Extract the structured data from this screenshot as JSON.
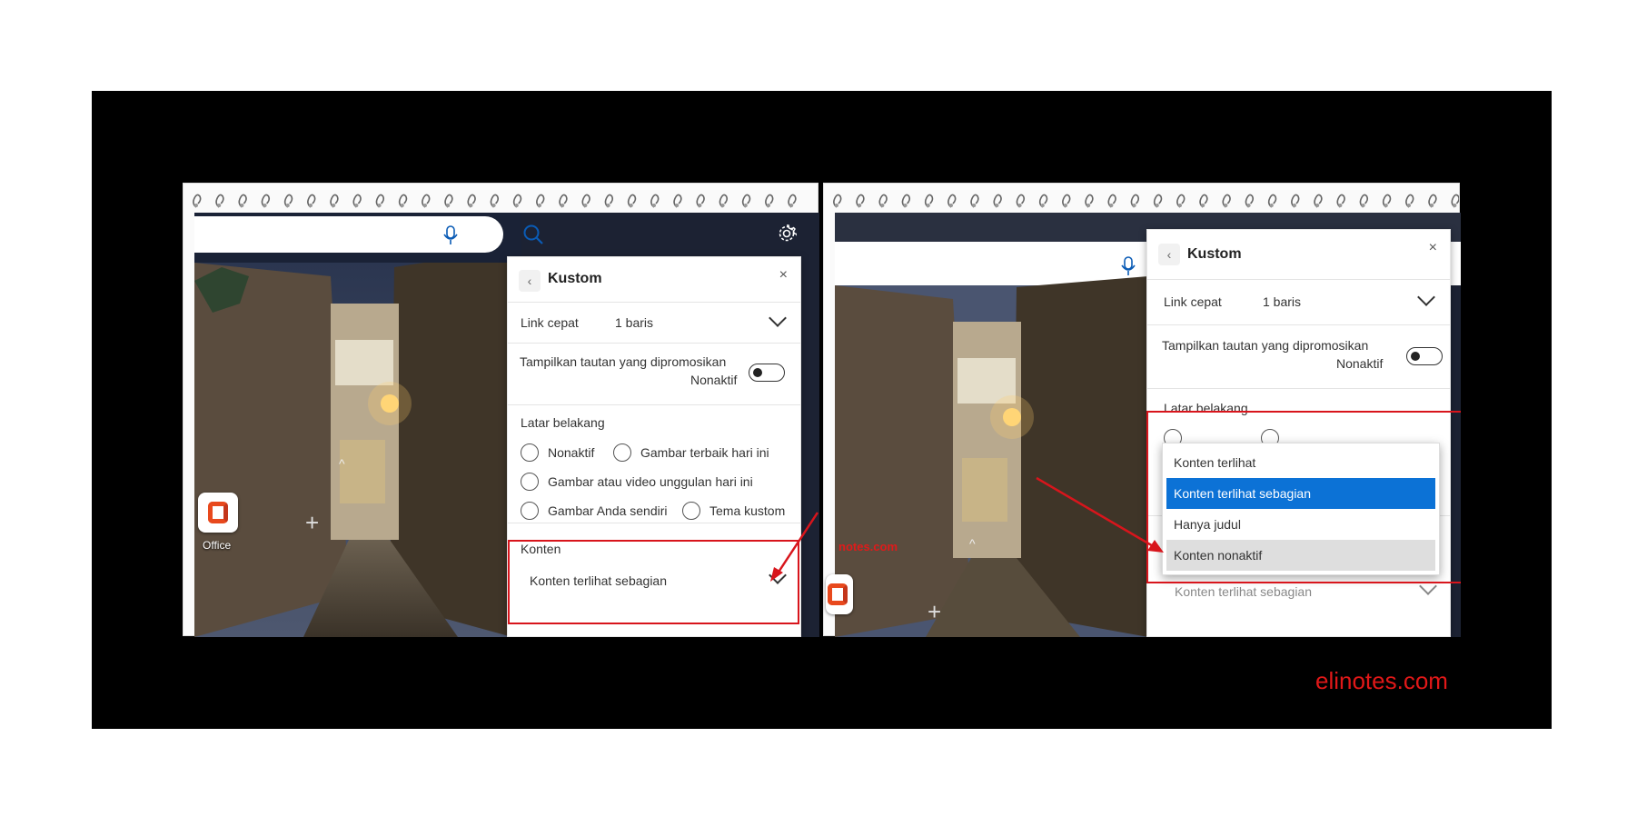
{
  "watermark": "elinotes.com",
  "office_tile": {
    "label": "Office"
  },
  "panel": {
    "title": "Kustom",
    "back_glyph": "‹",
    "close_glyph": "×",
    "quick_links": {
      "label": "Link cepat",
      "value": "1 baris"
    },
    "promoted": {
      "label": "Tampilkan tautan yang dipromosikan",
      "state": "Nonaktif"
    },
    "background": {
      "label": "Latar belakang",
      "options": [
        "Nonaktif",
        "Gambar terbaik hari ini",
        "Gambar atau video unggulan hari ini",
        "Gambar Anda sendiri",
        "Tema kustom"
      ]
    },
    "content": {
      "label": "Konten",
      "value": "Konten terlihat sebagian"
    }
  },
  "dropdown": {
    "items": [
      "Konten terlihat",
      "Konten terlihat sebagian",
      "Hanya judul",
      "Konten nonaktif"
    ],
    "selected_index": 1,
    "hovered_index": 3
  },
  "bg_fragment": "notes.com",
  "icons": {
    "mic": "microphone-icon",
    "search": "search-icon",
    "settings": "gear-icon",
    "back": "chevron-left-icon",
    "close": "close-icon",
    "chevron": "chevron-down-icon",
    "add": "plus-icon"
  },
  "colors": {
    "accent": "#0c72d6",
    "annotation": "#d8151c",
    "watermark": "#e01818"
  }
}
